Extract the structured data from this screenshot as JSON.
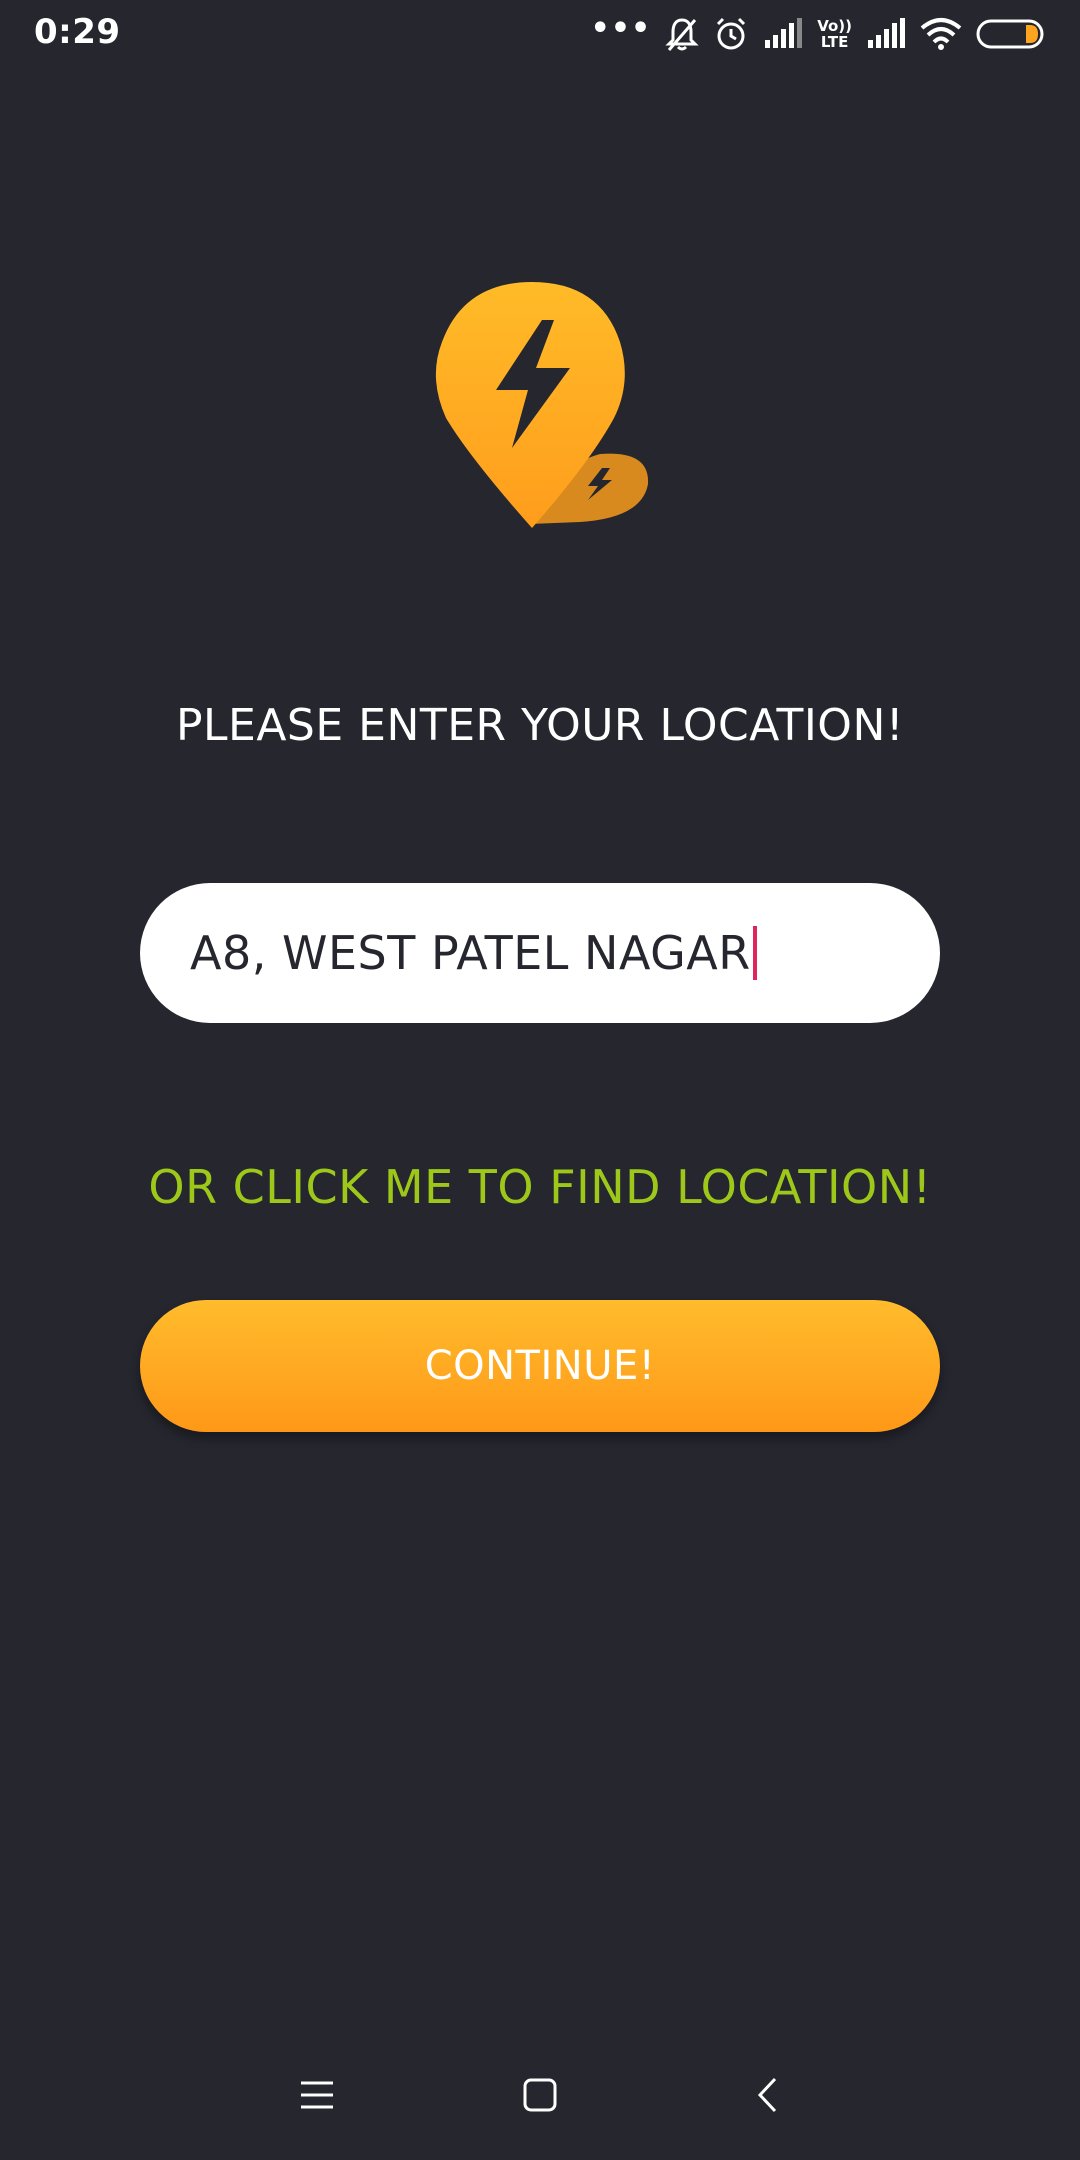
{
  "status_bar": {
    "time": "0:29",
    "more": "•••",
    "volte_label_top": "Vo))",
    "volte_label_bottom": "LTE",
    "icons": [
      "more-dots-icon",
      "bell-muted-icon",
      "alarm-icon",
      "signal-icon",
      "volte-icon",
      "signal-icon",
      "wifi-icon",
      "battery-icon"
    ]
  },
  "logo": {
    "icon": "lightning-pin-logo",
    "colors": {
      "primary": "#ffad1f",
      "secondary": "#d88a1e",
      "bolt": "#25262e"
    }
  },
  "main": {
    "heading": "PLEASE ENTER YOUR LOCATION!",
    "location_input": {
      "value": "A8, WEST PATEL NAGAR",
      "cursor_color": "#e0245e"
    },
    "find_location_link": "OR CLICK ME TO FIND LOCATION!",
    "continue_button": "CONTINUE!"
  },
  "nav_bar": {
    "buttons": [
      "menu-icon",
      "home-icon",
      "back-icon"
    ]
  },
  "colors": {
    "background": "#25262e",
    "accent": "#ffa41f",
    "link": "#9dc81a",
    "text": "#ffffff"
  }
}
